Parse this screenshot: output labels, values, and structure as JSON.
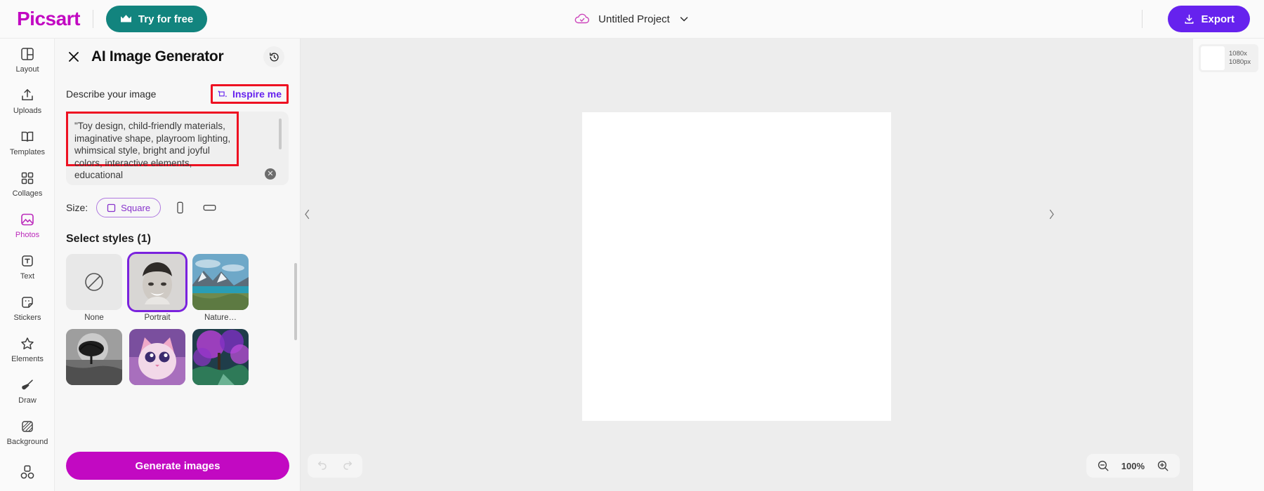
{
  "topbar": {
    "logo": "Picsart",
    "try_label": "Try for free",
    "try_icon": "crown-icon",
    "project_name": "Untitled Project",
    "project_icon": "cloud-check-icon",
    "project_chevron": "chevron-down-icon",
    "export_label": "Export",
    "export_icon": "download-icon"
  },
  "rail": {
    "items": [
      {
        "label": "Layout",
        "icon": "layout-icon",
        "active": false
      },
      {
        "label": "Uploads",
        "icon": "upload-icon",
        "active": false
      },
      {
        "label": "Templates",
        "icon": "templates-icon",
        "active": false
      },
      {
        "label": "Collages",
        "icon": "collages-icon",
        "active": false
      },
      {
        "label": "Photos",
        "icon": "photos-icon",
        "active": true
      },
      {
        "label": "Text",
        "icon": "text-icon",
        "active": false
      },
      {
        "label": "Stickers",
        "icon": "stickers-icon",
        "active": false
      },
      {
        "label": "Elements",
        "icon": "star-icon",
        "active": false
      },
      {
        "label": "Draw",
        "icon": "brush-icon",
        "active": false
      },
      {
        "label": "Background",
        "icon": "background-icon",
        "active": false
      },
      {
        "label": "",
        "icon": "shapes-icon",
        "active": false
      }
    ]
  },
  "panel": {
    "title": "AI Image Generator",
    "close_icon": "close-icon",
    "history_icon": "history-icon",
    "describe_label": "Describe your image",
    "inspire_label": "Inspire me",
    "inspire_icon": "sparkle-refresh-icon",
    "prompt_value": "\"Toy design, child-friendly materials, imaginative shape, playroom lighting, whimsical style, bright and joyful colors, interactive elements, educational",
    "clear_icon": "clear-circle-icon",
    "size_label": "Size:",
    "size_options": [
      {
        "label": "Square",
        "icon": "square-icon",
        "selected": true
      },
      {
        "label": "Portrait",
        "icon": "portrait-icon",
        "selected": false
      },
      {
        "label": "Landscape",
        "icon": "landscape-icon",
        "selected": false
      }
    ],
    "styles_heading": "Select styles (1)",
    "styles": [
      {
        "label": "None",
        "selected": false,
        "kind": "none"
      },
      {
        "label": "Portrait",
        "selected": true,
        "kind": "portrait"
      },
      {
        "label": "Nature…",
        "selected": false,
        "kind": "nature"
      },
      {
        "label": "",
        "selected": false,
        "kind": "bw-tree"
      },
      {
        "label": "",
        "selected": false,
        "kind": "cat"
      },
      {
        "label": "",
        "selected": false,
        "kind": "magic"
      }
    ],
    "generate_label": "Generate images"
  },
  "canvas": {
    "collapse_left_icon": "chevron-left-icon",
    "collapse_right_icon": "chevron-right-icon",
    "undo_icon": "undo-icon",
    "redo_icon": "redo-icon",
    "zoom_out_icon": "zoom-out-icon",
    "zoom_in_icon": "zoom-in-icon",
    "zoom_value": "100%",
    "settings_icon": "gear-icon"
  },
  "right_panel": {
    "layer_size_line1": "1080x",
    "layer_size_line2": "1080px"
  },
  "colors": {
    "brand_magenta": "#c209c2",
    "teal": "#12847e",
    "purple": "#6622ee",
    "highlight_red": "#ee1122",
    "selected_style": "#7a22dd"
  }
}
